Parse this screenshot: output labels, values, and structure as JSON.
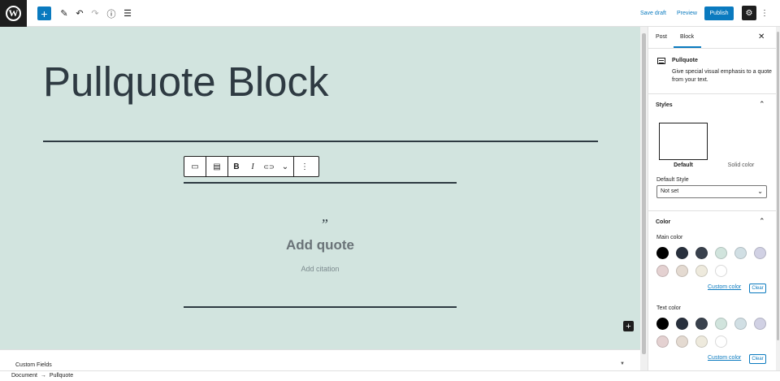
{
  "topbar": {
    "logo_glyph": "W",
    "add_icon": "+",
    "edit_icon": "✎",
    "undo_icon": "↶",
    "redo_icon": "↷",
    "info_icon": "ⓘ",
    "list_icon": "☰",
    "save_draft": "Save draft",
    "preview": "Preview",
    "publish": "Publish",
    "settings_icon": "⚙",
    "more_icon": "⋮"
  },
  "editor": {
    "title": "Pullquote Block",
    "quote_mark": "”",
    "quote_placeholder": "Add quote",
    "citation_placeholder": "Add citation",
    "inserter_icon": "+"
  },
  "block_toolbar": {
    "block_icon": "▭",
    "align_icon": "▤",
    "bold": "B",
    "italic": "I",
    "link_icon": "⊂⊃",
    "more_formats_icon": "⌄",
    "options_icon": "⋮"
  },
  "meta": {
    "custom_fields": "Custom Fields",
    "toggle_icon": "▼"
  },
  "footer": {
    "breadcrumb": [
      "Document",
      "→",
      "Pullquote"
    ]
  },
  "sidebar": {
    "tab_post": "Post",
    "tab_block": "Block",
    "close_icon": "✕",
    "block_name": "Pullquote",
    "block_description": "Give special visual emphasis to a quote from your text.",
    "styles_title": "Styles",
    "style_default": "Default",
    "style_solid": "Solid color",
    "default_style_label": "Default Style",
    "default_style_value": "Not set",
    "select_caret": "⌄",
    "color_title": "Color",
    "collapse_icon": "⌃",
    "main_color_label": "Main color",
    "text_color_label": "Text color",
    "custom_color": "Custom color",
    "clear": "Clear"
  },
  "palette": [
    "#000000",
    "#28303d",
    "#39414d",
    "#d1e4dd",
    "#d1dfe4",
    "#d1d1e4",
    "#e4d1d1",
    "#e4dad1",
    "#eeeadd",
    "#ffffff"
  ]
}
